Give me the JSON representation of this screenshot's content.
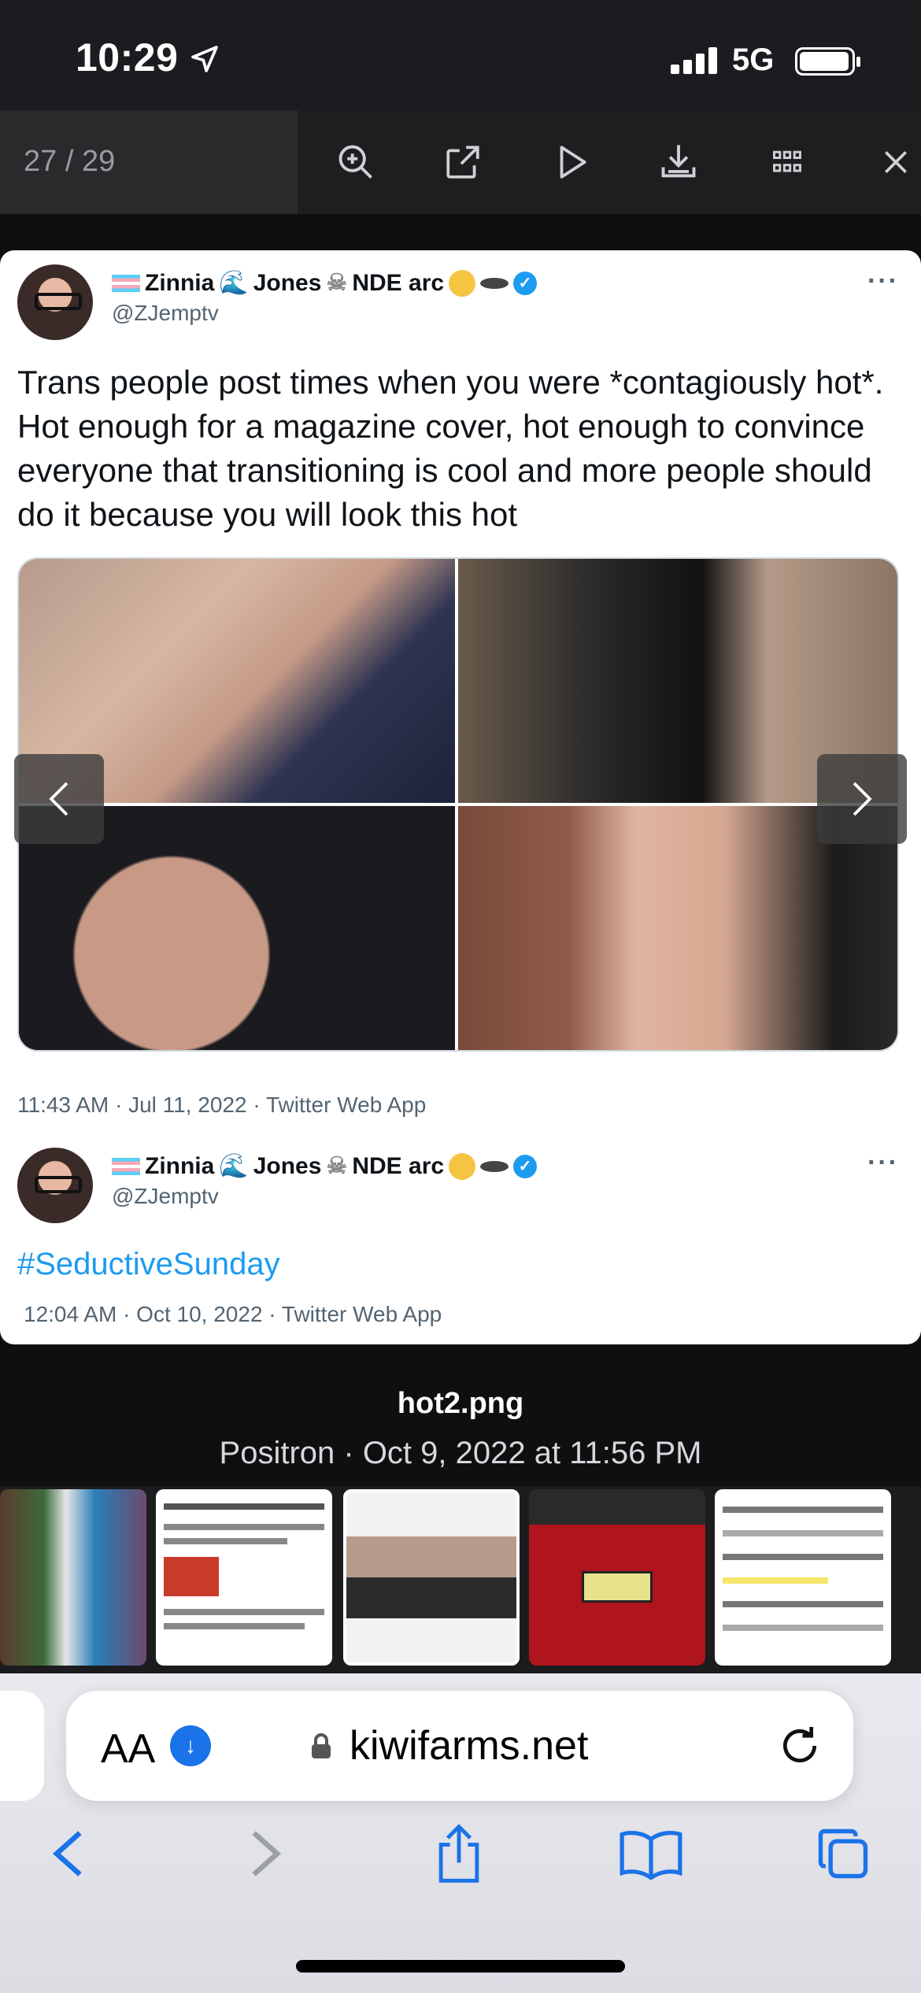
{
  "status_bar": {
    "time": "10:29",
    "network": "5G",
    "battery": "full"
  },
  "viewer": {
    "pager": "27 / 29",
    "tools": [
      "zoom-in-icon",
      "open-external-icon",
      "play-icon",
      "download-icon",
      "grid-icon",
      "close-icon"
    ]
  },
  "tweet": {
    "author_name": "Zinnia",
    "author_surname": "Jones",
    "author_suffix": "NDE arc",
    "handle": "@ZJemptv",
    "more": "···",
    "text": "Trans people post times when you were *contagiously hot*. Hot enough for a magazine cover, hot enough to convince everyone that transitioning is cool and more people should do it because you will look this hot",
    "timestamp": "11:43 AM · Jul 11, 2022 · Twitter Web App",
    "quote": {
      "author_name": "Zinnia",
      "author_surname": "Jones",
      "author_suffix": "NDE arc",
      "handle": "@ZJemptv",
      "hashtag": "#SeductiveSunday",
      "timestamp": "12:04 AM · Oct 10, 2022 · Twitter Web App"
    }
  },
  "caption": {
    "filename": "hot2.png",
    "subtitle": "Positron · Oct 9, 2022 at 11:56 PM"
  },
  "safari": {
    "aa_label": "AA",
    "domain": "kiwifarms.net"
  },
  "colors": {
    "accent": "#1d9bf0",
    "safari_blue": "#1a73e8"
  }
}
